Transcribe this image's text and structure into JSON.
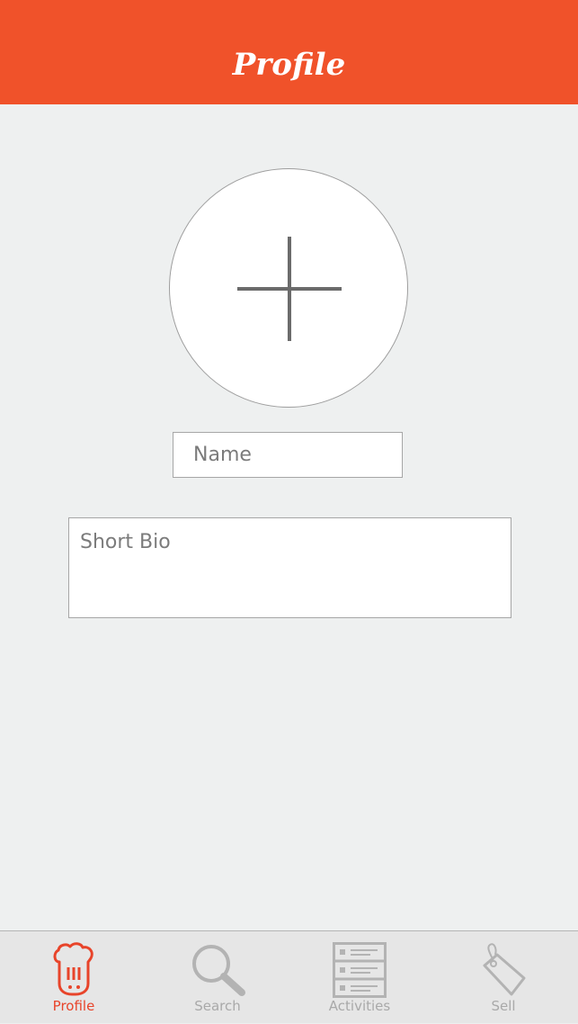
{
  "header": {
    "title": "Profile",
    "background_color": "#f0522a"
  },
  "profile_form": {
    "avatar_icon": "plus-icon",
    "name_placeholder": "Name",
    "bio_placeholder": "Short Bio"
  },
  "tabbar": {
    "active_color": "#e8442a",
    "inactive_color": "#a9a9a9",
    "tabs": [
      {
        "label": "Profile",
        "icon": "chef-hat-icon",
        "active": true
      },
      {
        "label": "Search",
        "icon": "magnifier-icon",
        "active": false
      },
      {
        "label": "Activities",
        "icon": "list-icon",
        "active": false
      },
      {
        "label": "Sell",
        "icon": "price-tag-icon",
        "active": false
      }
    ]
  }
}
